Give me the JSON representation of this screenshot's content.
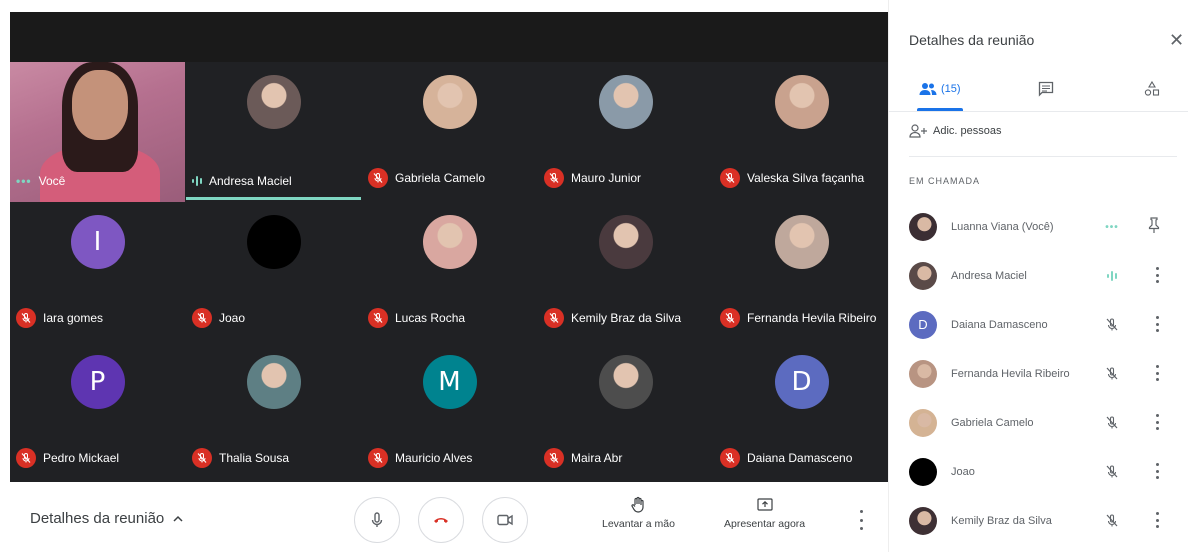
{
  "tiles": [
    {
      "name": "Você",
      "kind": "self",
      "status": "dots"
    },
    {
      "name": "Andresa Maciel",
      "kind": "photo",
      "color": "#6b5a58",
      "status": "speaking"
    },
    {
      "name": "Gabriela Camelo",
      "kind": "photo",
      "color": "#d6b39a",
      "status": "muted"
    },
    {
      "name": "Mauro Junior",
      "kind": "photo",
      "color": "#8a9aa8",
      "status": "muted"
    },
    {
      "name": "Valeska Silva façanha",
      "kind": "photo",
      "color": "#c9a28e",
      "status": "muted"
    },
    {
      "name": "Iara gomes",
      "kind": "initial",
      "initial": "I",
      "color": "#7e57c2",
      "status": "muted"
    },
    {
      "name": "Joao",
      "kind": "initial",
      "initial": "",
      "color": "#000000",
      "status": "muted"
    },
    {
      "name": "Lucas Rocha",
      "kind": "photo",
      "color": "#d9a7a0",
      "status": "muted"
    },
    {
      "name": "Kemily Braz da Silva",
      "kind": "photo",
      "color": "#4a3a3e",
      "status": "muted"
    },
    {
      "name": "Fernanda Hevila Ribeiro",
      "kind": "photo",
      "color": "#bfa89c",
      "status": "muted"
    },
    {
      "name": "Pedro Mickael",
      "kind": "initial",
      "initial": "P",
      "color": "#5e35b1",
      "status": "muted"
    },
    {
      "name": "Thalia Sousa",
      "kind": "photo",
      "color": "#5e7f84",
      "status": "muted"
    },
    {
      "name": "Mauricio Alves",
      "kind": "initial",
      "initial": "M",
      "color": "#00838f",
      "status": "muted"
    },
    {
      "name": "Maira Abr",
      "kind": "photo",
      "color": "#4d4d4d",
      "status": "muted"
    },
    {
      "name": "Daiana Damasceno",
      "kind": "initial",
      "initial": "D",
      "color": "#5c6bc0",
      "status": "muted"
    }
  ],
  "bottom": {
    "details_label": "Detalhes da reunião",
    "raise_hand": "Levantar a mão",
    "present": "Apresentar agora"
  },
  "panel": {
    "title": "Detalhes da reunião",
    "people_count": "(15)",
    "add_people": "Adic. pessoas",
    "section": "EM CHAMADA",
    "participants": [
      {
        "name": "Luanna Viana (Você)",
        "kind": "photo",
        "color": "#3b2e33",
        "status": "dots",
        "action": "pin"
      },
      {
        "name": "Andresa Maciel",
        "kind": "photo",
        "color": "#5a4a48",
        "status": "speaking",
        "action": "menu"
      },
      {
        "name": "Daiana Damasceno",
        "kind": "initial",
        "initial": "D",
        "color": "#5c6bc0",
        "status": "muted",
        "action": "menu"
      },
      {
        "name": "Fernanda Hevila Ribeiro",
        "kind": "photo",
        "color": "#b89482",
        "status": "muted",
        "action": "menu"
      },
      {
        "name": "Gabriela Camelo",
        "kind": "photo",
        "color": "#d4b394",
        "status": "muted",
        "action": "menu"
      },
      {
        "name": "Joao",
        "kind": "initial",
        "initial": "",
        "color": "#000000",
        "status": "muted",
        "action": "menu"
      },
      {
        "name": "Kemily Braz da Silva",
        "kind": "photo",
        "color": "#3e3034",
        "status": "muted",
        "action": "menu"
      }
    ]
  }
}
